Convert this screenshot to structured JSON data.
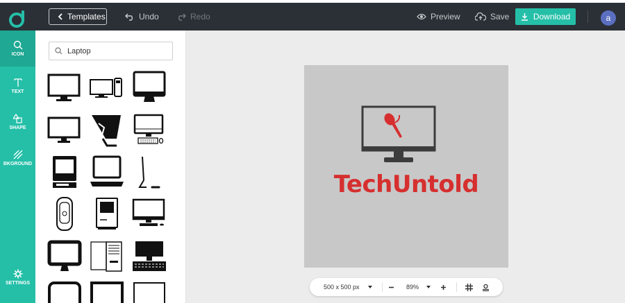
{
  "topbar": {
    "templates_label": "Templates",
    "undo_label": "Undo",
    "redo_label": "Redo",
    "preview_label": "Preview",
    "save_label": "Save",
    "download_label": "Download",
    "avatar_letter": "a",
    "accent_color": "#25bfa8"
  },
  "sidebar": {
    "items": [
      {
        "label": "ICON",
        "icon": "search-icon"
      },
      {
        "label": "TEXT",
        "icon": "text-icon"
      },
      {
        "label": "SHAPE",
        "icon": "shape-icon"
      },
      {
        "label": "BKGROUND",
        "icon": "background-icon"
      },
      {
        "label": "SETTINGS",
        "icon": "gear-icon"
      }
    ]
  },
  "panel": {
    "search_value": "Laptop",
    "icons": [
      "monitor-icon",
      "desktop-tower-icon",
      "imac-icon",
      "monitor-icon",
      "angled-monitor-icon",
      "desktop-keyboard-icon",
      "retro-computer-icon",
      "laptop-icon",
      "imac-side-icon",
      "mac-pro-icon",
      "classic-mac-icon",
      "monitor-keyboard-icon",
      "bold-monitor-icon",
      "tower-case-icon",
      "monitor-keyboard-icon",
      "rounded-monitor-icon",
      "monitor-icon",
      "monitor-icon"
    ]
  },
  "canvas": {
    "brand_text": "TechUntold",
    "brand_color": "#d62f2f"
  },
  "bottombar": {
    "size_label": "500 x 500 px",
    "zoom_label": "89%"
  }
}
